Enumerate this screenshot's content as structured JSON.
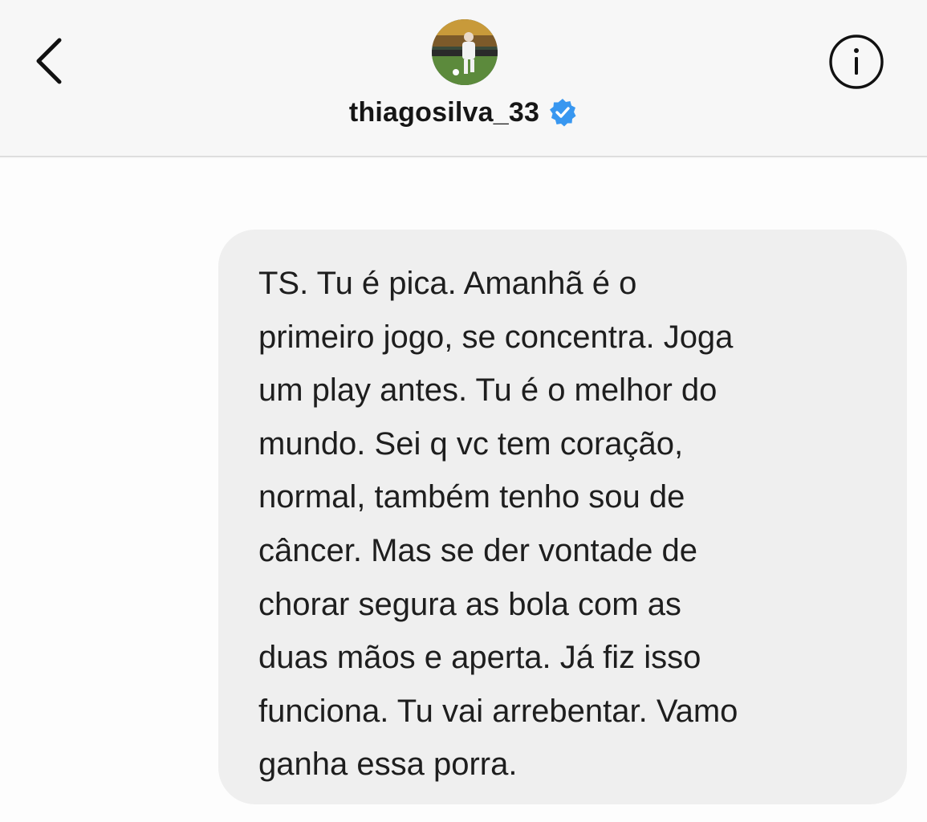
{
  "header": {
    "back_icon": "chevron-left-icon",
    "avatar_icon": "profile-photo-icon",
    "username": "thiagosilva_33",
    "verified_icon": "verified-badge-icon",
    "verified_color": "#3897f0",
    "info_icon": "info-circle-icon"
  },
  "message": {
    "text": "TS. Tu é pica. Amanhã é o\nprimeiro jogo, se concentra. Joga\num play antes. Tu é o melhor do\nmundo. Sei q vc tem coração,\nnormal, também tenho sou de\ncâncer. Mas se der vontade de\nchorar segura as bola com as\nduas mãos e aperta. Já fiz isso\nfunciona. Tu vai arrebentar. Vamo\nganha essa porra."
  },
  "colors": {
    "bubble_background": "#efefef",
    "header_background": "#f7f7f7"
  }
}
